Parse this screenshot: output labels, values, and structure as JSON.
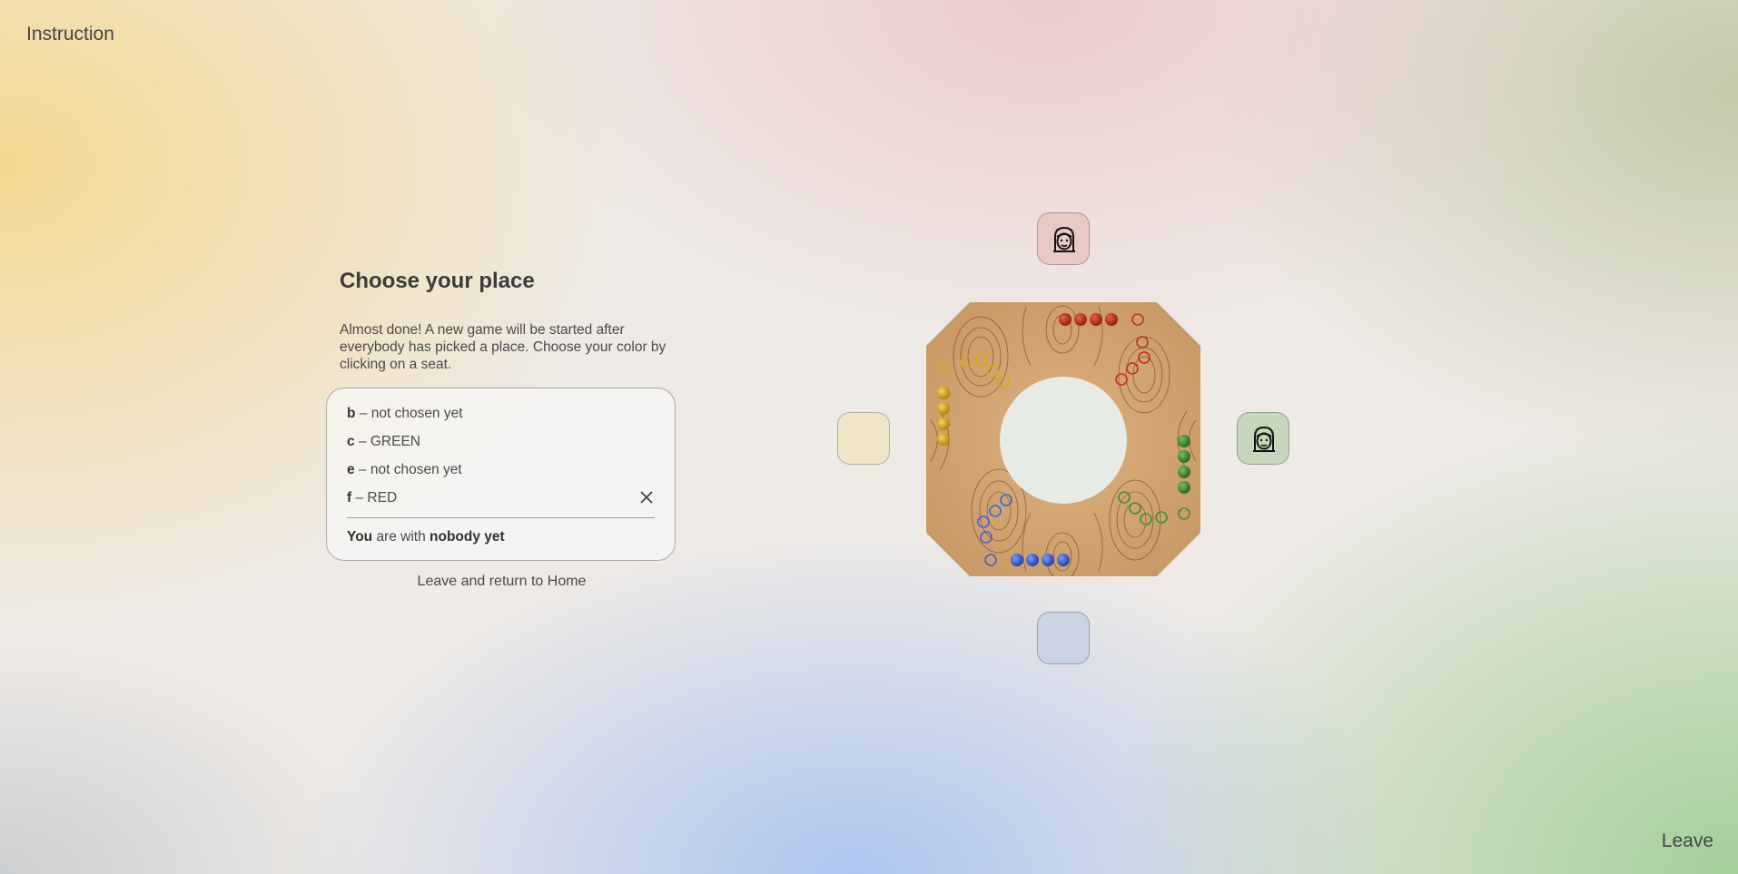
{
  "header": {
    "instruction_label": "Instruction"
  },
  "footer": {
    "leave_label": "Leave"
  },
  "panel": {
    "title": "Choose your place",
    "description": "Almost done! A new game will be started after everybody has picked a place. Choose your color by clicking on a seat.",
    "players": [
      {
        "name": "b",
        "separator": "–",
        "status": "not chosen yet"
      },
      {
        "name": "c",
        "separator": "–",
        "status": "GREEN"
      },
      {
        "name": "e",
        "separator": "–",
        "status": "not chosen yet"
      },
      {
        "name": "f",
        "separator": "–",
        "status": "RED"
      }
    ],
    "status_you": "You",
    "status_text": "are with",
    "status_value": "nobody yet",
    "leave_home_label": "Leave and return to Home"
  },
  "seats": {
    "top": {
      "color": "#e8c9c4",
      "occupied": true,
      "icon": "girl-avatar-icon"
    },
    "left": {
      "color": "#efe6c8",
      "occupied": false
    },
    "right": {
      "color": "#c5d7bc",
      "occupied": true,
      "icon": "girl-avatar-icon"
    },
    "bottom": {
      "color": "#cbd4e6",
      "occupied": false
    }
  },
  "board": {
    "colors": {
      "red": "#c0301f",
      "green": "#3e8f35",
      "blue": "#3b63d6",
      "yellow": "#d9a90f",
      "wood": "#d2a574"
    },
    "pieces_per_home": 4
  }
}
